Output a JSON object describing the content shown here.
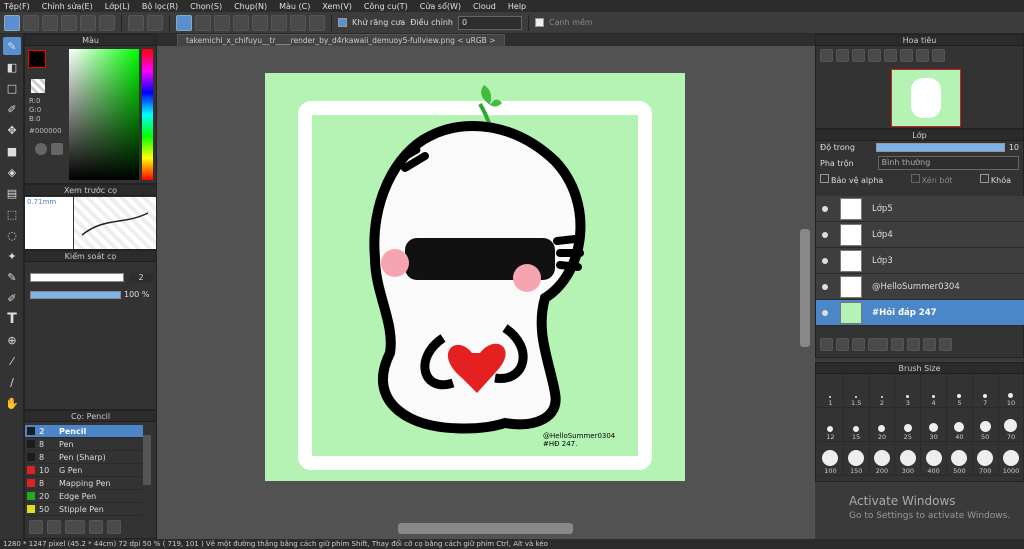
{
  "menu": [
    "Tệp(F)",
    "Chỉnh sửa(E)",
    "Lớp(L)",
    "Bộ lọc(R)",
    "Chọn(S)",
    "Chụp(N)",
    "Màu (C)",
    "Xem(V)",
    "Công cụ(T)",
    "Cửa sổ(W)",
    "Cloud",
    "Help"
  ],
  "toolbar": {
    "antialias_label": "Khử răng cưa",
    "adjust_label": "Điều chỉnh",
    "adjust_value": "0",
    "smooth_label": "Cạnh mềm"
  },
  "color_panel": {
    "title": "Màu",
    "r": "R:0",
    "g": "G:0",
    "b": "B:0",
    "hex": "#000000"
  },
  "preview_panel": {
    "title": "Xem trước cọ",
    "size": "0.71mm"
  },
  "brush_control": {
    "title": "Kiểm soát cọ",
    "size": "2",
    "opacity": "100 %",
    "opacity_fraction": 1.0
  },
  "brush_list": {
    "title": "Cọ: Pencil",
    "items": [
      {
        "size": "2",
        "name": "Pencil",
        "color": "#1c1c1c"
      },
      {
        "size": "8",
        "name": "Pen",
        "color": "#1c1c1c"
      },
      {
        "size": "8",
        "name": "Pen (Sharp)",
        "color": "#1c1c1c"
      },
      {
        "size": "10",
        "name": "G Pen",
        "color": "#d22"
      },
      {
        "size": "8",
        "name": "Mapping Pen",
        "color": "#d22"
      },
      {
        "size": "20",
        "name": "Edge Pen",
        "color": "#2a2"
      },
      {
        "size": "50",
        "name": "Stipple Pen",
        "color": "#dd2"
      }
    ]
  },
  "document": {
    "tab": "takemichi_x_chifuyu__tr____render_by_d4rkawaii_demuoy5-fullview.png < uRGB >",
    "signature_line1": "@HelloSummer0304",
    "signature_line2": "#HĐ 247."
  },
  "navigator": {
    "title": "Hoa tiêu"
  },
  "layers": {
    "title": "Lớp",
    "opacity_label": "Độ trong",
    "opacity_value": "10",
    "blend_label": "Pha trộn",
    "blend_value": "Bình thường",
    "protect_alpha": "Bảo vệ alpha",
    "clip": "Xén bớt",
    "lock": "Khóa",
    "items": [
      {
        "name": "Lớp5"
      },
      {
        "name": "Lớp4"
      },
      {
        "name": "Lớp3"
      },
      {
        "name": "@HelloSummer0304"
      },
      {
        "name": "#Hỏi đáp 247"
      }
    ]
  },
  "brush_size": {
    "title": "Brush Size",
    "sizes": [
      "1",
      "1.5",
      "2",
      "3",
      "4",
      "5",
      "7",
      "10",
      "12",
      "15",
      "20",
      "25",
      "30",
      "40",
      "50",
      "70",
      "100",
      "150",
      "200",
      "300",
      "400",
      "500",
      "700",
      "1000"
    ]
  },
  "status": "1280 * 1247 pixel   (45.2 * 44cm)   72 dpi   50 %   ( 719, 101 )   Vẽ một đường thẳng bằng cách giữ phím Shift, Thay đổi cỡ cọ bằng cách giữ phím Ctrl, Alt và kéo",
  "watermark": {
    "line1": "Activate Windows",
    "line2": "Go to Settings to activate Windows."
  }
}
